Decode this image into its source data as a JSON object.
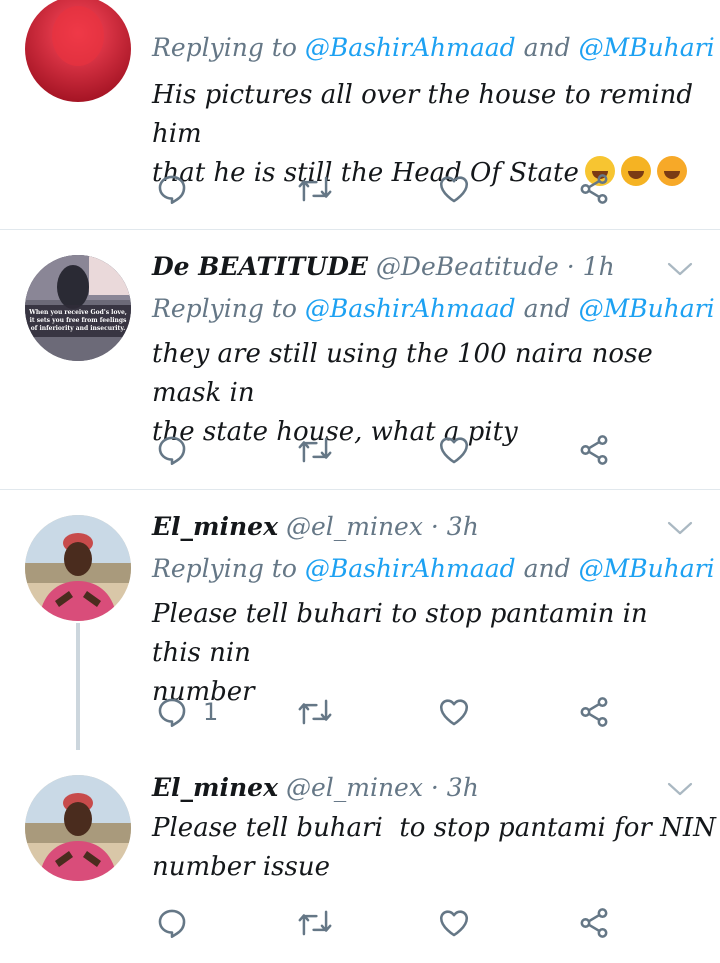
{
  "tweets": [
    {
      "name": "",
      "handle": "",
      "time": "",
      "replying_prefix": "Replying to",
      "mention_1": "@BashirAhmaad",
      "replying_and": "and",
      "mention_2": "@MBuhari",
      "text_line_1": "His pictures all over the house to remind him",
      "text_line_2": "that he is still the Head Of State",
      "emojis": [
        "grinning-face-emoji",
        "rolling-laughing-emoji",
        "crying-face-emoji"
      ],
      "reply_count": ""
    },
    {
      "name": "De BEATITUDE",
      "handle": "@DeBeatitude",
      "time": "· 1h",
      "avatar_text": "When you receive God's love, it sets you free from feelings of inferiority and insecurity.",
      "replying_prefix": "Replying to",
      "mention_1": "@BashirAhmaad",
      "replying_and": "and",
      "mention_2": "@MBuhari",
      "text_line_1": "they are still using the 100 naira nose mask in",
      "text_line_2": "the state house, what a pity",
      "reply_count": ""
    },
    {
      "name": "El_minex",
      "handle": "@el_minex",
      "time": "· 3h",
      "replying_prefix": "Replying to",
      "mention_1": "@BashirAhmaad",
      "replying_and": "and",
      "mention_2": "@MBuhari",
      "text_line_1": "Please tell buhari to stop pantamin in this nin",
      "text_line_2": "number",
      "reply_count": "1"
    },
    {
      "name": "El_minex",
      "handle": "@el_minex",
      "time": "· 3h",
      "text_line_1": "Please tell buhari  to stop pantami for NIN",
      "text_line_2": "number issue",
      "reply_count": ""
    }
  ],
  "icons": {
    "reply": "reply-icon",
    "retweet": "retweet-icon",
    "like": "heart-icon",
    "share": "share-icon",
    "more": "chevron-down-icon"
  },
  "colors": {
    "icon_gray": "#657786",
    "link_blue": "#1da1f2",
    "divider": "#e1e8ed"
  }
}
